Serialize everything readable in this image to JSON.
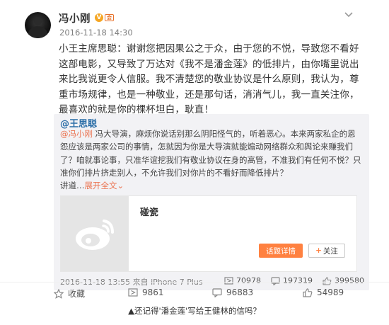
{
  "post": {
    "author_name": "冯小刚",
    "verified_badge": "V",
    "member_badge": "会",
    "time": "2016-11-18 14:30",
    "text": "小王主席思聪：谢谢您把因果公之于众，由于您的不悦，导致您不看好这部电影，又导致了万达对《我不是潘金莲》的低排片，由你嘴里说出来比我说更令人信服。我不清楚您的敬业协议是什么原则，我认为，尊重市场规律，也是一种敬业，还是那句话，消消气儿，我一直关注你，最喜欢的就是你的棵杯坦白，耿直！"
  },
  "repost": {
    "author_at": "@王思聪",
    "mention": "@冯小刚",
    "text": " 冯大导演，麻烦你说话别那么阴阳怪气的，听着恶心。本来两家私企的恩怨应该是两家公司的事情，怎就因为你是大导演就能煽动网络群众和舆论来赚我们了？咱就事论事，只准华谊挖我们有敬业协议在身的高管，不准我们有任何不悦？只准你们排片挤走别人，不允许我们对你片的不看好而降低排片？",
    "ellipsis": "讲道…",
    "expand_label": "展开全文",
    "expand_arrow": "⌄",
    "link_card": {
      "title": "碰瓷",
      "topic_button": "话题详情",
      "follow_plus": "+",
      "follow_label": "关注"
    },
    "meta": "2016-11-18 13:55 来自 iPhone 7 Plus",
    "repost_count": "70978",
    "comment_count": "197319",
    "like_count": "399580"
  },
  "actions": {
    "favorite_label": "收藏",
    "repost_count": "9861",
    "comment_count": "96883",
    "like_count": "54989"
  },
  "caption": "▲还记得'潘金莲'写给王健林的信吗？",
  "colors": {
    "link_blue": "#2b6ea7",
    "mention_orange": "#eb7350",
    "topic_button": "#ff8140",
    "repost_bg": "#f2f2f5"
  },
  "icons": [
    "chevron-down-icon",
    "star-icon",
    "repost-icon",
    "comment-icon",
    "like-icon",
    "weibo-logo-icon"
  ]
}
